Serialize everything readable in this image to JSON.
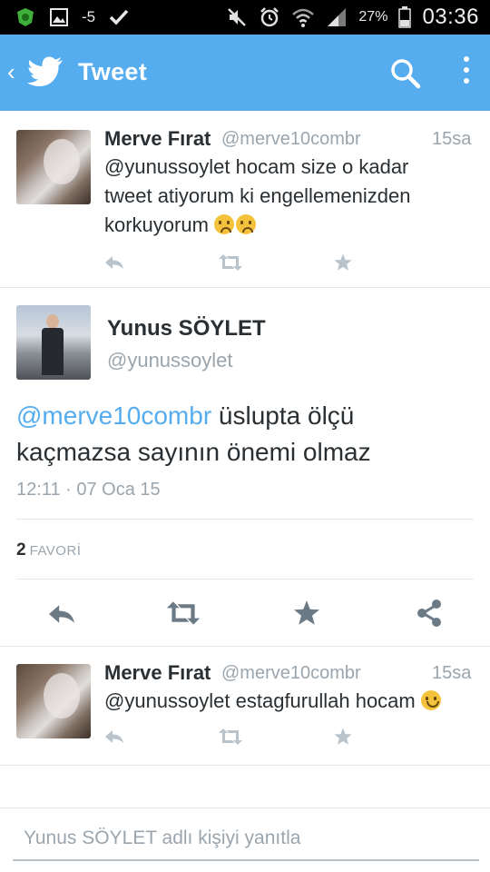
{
  "status_bar": {
    "signal_value": "-5",
    "battery": "27%",
    "time": "03:36",
    "left_icons": [
      "shield-app-icon",
      "image-icon",
      "check-icon"
    ],
    "right_icons": [
      "mute-icon",
      "alarm-icon",
      "wifi-icon",
      "signal-icon",
      "battery-icon"
    ]
  },
  "appbar": {
    "title": "Tweet",
    "color": "#55acee",
    "icons": [
      "back-icon",
      "twitter-bird-icon",
      "search-icon",
      "overflow-menu-icon"
    ]
  },
  "tweets": [
    {
      "name": "Merve Fırat",
      "handle": "@merve10combr",
      "time": "15sa",
      "text_lines": [
        "@yunussoylet hocam size o kadar",
        "tweet atiyorum ki engellemenizden",
        "korkuyorum"
      ]
    },
    {
      "name": "Merve Fırat",
      "handle": "@merve10combr",
      "time": "15sa",
      "text": "@yunussoylet estagfurullah hocam"
    }
  ],
  "detail": {
    "name": "Yunus SÖYLET",
    "handle": "@yunussoylet",
    "mention": "@merve10combr",
    "text_line1_rest": " üslupta ölçü",
    "text_line2": "kaçmazsa sayının önemi olmaz",
    "meta": "12:11 · 07 Oca 15",
    "fav_count": "2",
    "fav_label": "FAVORİ"
  },
  "reply": {
    "placeholder": "Yunus SÖYLET adlı kişiyi yanıtla"
  },
  "colors": {
    "accent": "#55acee",
    "text": "#292f33",
    "muted": "#9aa5ae",
    "action_light": "#b8c3cc",
    "action_dark": "#6c7a86"
  }
}
